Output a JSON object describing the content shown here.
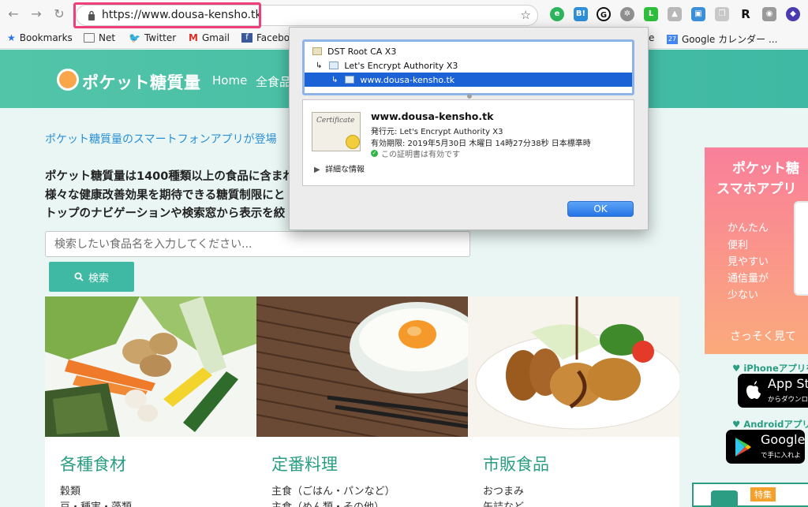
{
  "browser": {
    "url": "https://www.dousa-kensho.tk",
    "bookmarks": [
      {
        "label": "Bookmarks"
      },
      {
        "label": "Net"
      },
      {
        "label": "Twitter"
      },
      {
        "label": "Gmail"
      },
      {
        "label": "Facebo"
      },
      {
        "label": "e"
      },
      {
        "label": "Google カレンダー ..."
      }
    ],
    "calendar_day": "27"
  },
  "site": {
    "logo_text": "ポケット糖質量",
    "nav": [
      "Home",
      "全食品"
    ],
    "announcement": "ポケット糖質量のスマートフォンアプリが登場",
    "intro_lines": [
      "ポケット糖質量は1400種類以上の食品に含まれ",
      "様々な健康改善効果を期待できる糖質制限にと",
      "トップのナビゲーションや検索窓から表示を絞"
    ],
    "search": {
      "placeholder": "検索したい食品名を入力してください...",
      "button_label": "検索"
    },
    "cards": [
      {
        "title": "各種食材",
        "items": [
          "穀類",
          "豆・種実・藻類"
        ]
      },
      {
        "title": "定番料理",
        "items": [
          "主食（ごはん・パンなど）",
          "主食（めん類・その他）"
        ]
      },
      {
        "title": "市販食品",
        "items": [
          "おつまみ",
          "缶詰など"
        ]
      }
    ]
  },
  "sidebar": {
    "promo_title": [
      "ポケット糖",
      "スマホアプリ"
    ],
    "promo_features": [
      "かんたん",
      "便利",
      "見やすい",
      "通信量が",
      "少ない"
    ],
    "promo_cta": "さっそく見て",
    "iphone_label": "iPhoneアプリを",
    "app_store": {
      "main": "App St",
      "sub": "からダウンロ"
    },
    "android_label": "Androidアプリを",
    "google_play": {
      "main": "Google I",
      "sub": "で手に入れよ"
    },
    "feature_tag": "特集"
  },
  "certificate": {
    "chain": [
      {
        "label": "DST Root CA X3"
      },
      {
        "label": "Let's Encrypt Authority X3"
      },
      {
        "label": "www.dousa-kensho.tk"
      }
    ],
    "badge_text": "Certificate",
    "name": "www.dousa-kensho.tk",
    "issuer": "発行元: Let's Encrypt Authority X3",
    "expiry": "有効期限: 2019年5月30日 木曜日 14時27分38秒 日本標準時",
    "status": "この証明書は有効です",
    "more": "詳細な情報",
    "ok_label": "OK"
  },
  "colors": {
    "brand": "#3fb9a3",
    "url_highlight": "#ee3f7c",
    "selection": "#1b62d6",
    "promo": "#f97f9a"
  }
}
